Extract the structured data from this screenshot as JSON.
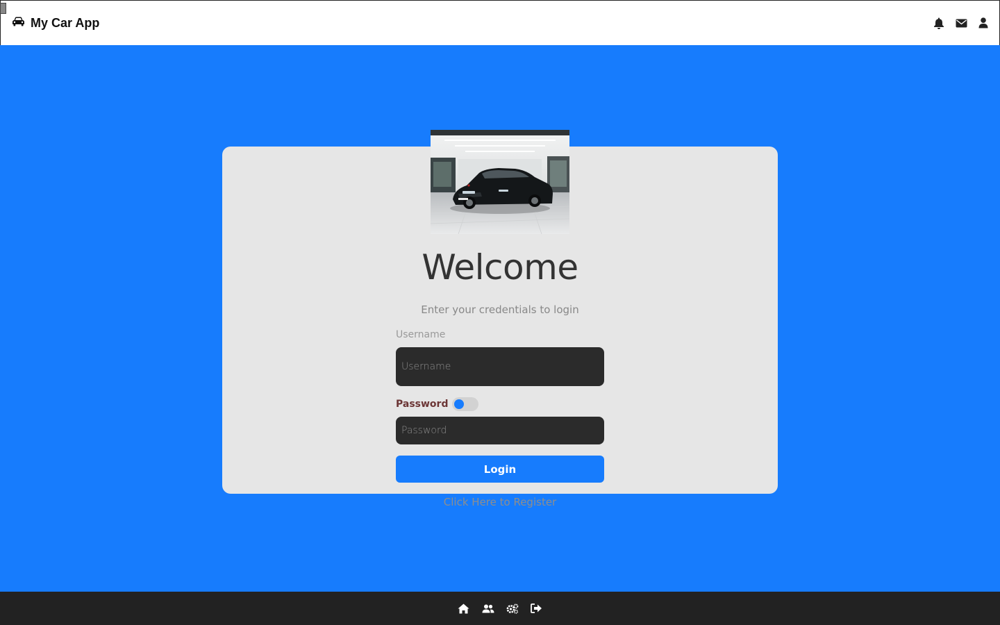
{
  "header": {
    "app_name": "My Car App",
    "icons": [
      "car-icon",
      "bell-icon",
      "envelope-icon",
      "user-icon"
    ]
  },
  "login": {
    "title": "Welcome",
    "subtitle": "Enter your credentials to login",
    "username_label": "Username",
    "username_placeholder": "Username",
    "username_value": "",
    "password_label": "Password",
    "password_placeholder": "Password",
    "password_value": "",
    "show_password_toggle_on": false,
    "login_label": "Login",
    "register_link": "Click Here to Register"
  },
  "footer": {
    "icons": [
      "home-icon",
      "users-icon",
      "settings-icon",
      "logout-icon"
    ]
  },
  "colors": {
    "accent": "#177cfd",
    "card_bg": "#e6e6e6",
    "input_bg": "#2b2b2b",
    "footer_bg": "#222222"
  }
}
